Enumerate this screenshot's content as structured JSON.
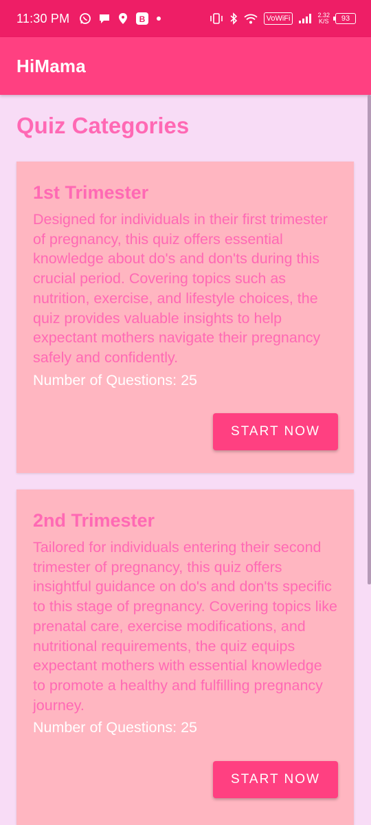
{
  "status_bar": {
    "time": "11:30 PM",
    "badge_letter": "B",
    "vowifi": "VoWiFi",
    "net_speed_value": "2.32",
    "net_speed_unit": "K/S",
    "battery": "93"
  },
  "app_bar": {
    "title": "HiMama"
  },
  "page": {
    "title": "Quiz Categories"
  },
  "cards": [
    {
      "title": "1st Trimester",
      "description": "Designed for individuals in their first trimester of pregnancy, this quiz offers essential knowledge about do's and don'ts during this crucial period. Covering topics such as nutrition, exercise, and lifestyle choices, the quiz provides valuable insights to help expectant mothers navigate their pregnancy safely and confidently.",
      "questions": "Number of Questions: 25",
      "button": "START NOW"
    },
    {
      "title": "2nd Trimester",
      "description": "Tailored for individuals entering their second trimester of pregnancy, this quiz offers insightful guidance on do's and don'ts specific to this stage of pregnancy. Covering topics like prenatal care, exercise modifications, and nutritional requirements, the quiz equips expectant mothers with essential knowledge to promote a healthy and fulfilling pregnancy journey.",
      "questions": "Number of Questions: 25",
      "button": "START NOW"
    }
  ],
  "colors": {
    "status_bar": "#ee1e66",
    "app_bar": "#ff4081",
    "background": "#f8dcf6",
    "card": "#ffb6c1",
    "accent_text": "#ff69b4",
    "button": "#ff4081"
  }
}
